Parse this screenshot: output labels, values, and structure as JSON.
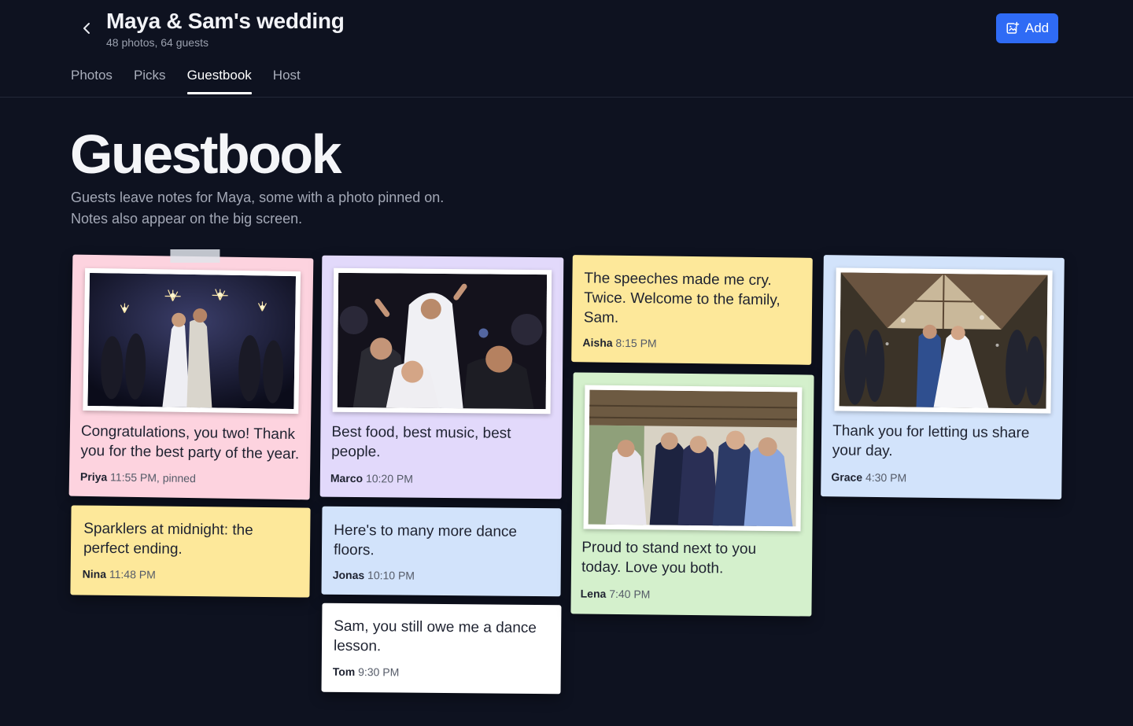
{
  "header": {
    "title": "Maya & Sam's wedding",
    "subtitle": "48 photos, 64 guests",
    "add_label": "Add"
  },
  "tabs": [
    {
      "label": "Photos",
      "active": false
    },
    {
      "label": "Picks",
      "active": false
    },
    {
      "label": "Guestbook",
      "active": true
    },
    {
      "label": "Host",
      "active": false
    }
  ],
  "main": {
    "title": "Guestbook",
    "description_line1": "Guests leave notes for Maya, some with a photo pinned on.",
    "description_line2": "Notes also appear on the big screen."
  },
  "notes": [
    {
      "message": "Congratulations, you two! Thank you for the best party of the year.",
      "author": "Priya",
      "time": "11:55 PM, pinned",
      "color": "#fdd3df",
      "photo": "sparkler-send-off-photo"
    },
    {
      "message": "Sparklers at midnight: the perfect ending.",
      "author": "Nina",
      "time": "11:48 PM",
      "color": "#fde89a"
    },
    {
      "message": "Best food, best music, best people.",
      "author": "Marco",
      "time": "10:20 PM",
      "color": "#e2d9fb",
      "photo": "dance-floor-photo"
    },
    {
      "message": "Here's to many more dance floors.",
      "author": "Jonas",
      "time": "10:10 PM",
      "color": "#d2e3fb"
    },
    {
      "message": "Sam, you still owe me a dance lesson.",
      "author": "Tom",
      "time": "9:30 PM",
      "color": "#ffffff"
    },
    {
      "message": "The speeches made me cry. Twice. Welcome to the family, Sam.",
      "author": "Aisha",
      "time": "8:15 PM",
      "color": "#fde89a"
    },
    {
      "message": "Proud to stand next to you today. Love you both.",
      "author": "Lena",
      "time": "7:40 PM",
      "color": "#d4f0cc",
      "photo": "bridesmaids-photo"
    },
    {
      "message": "Thank you for letting us share your day.",
      "author": "Grace",
      "time": "4:30 PM",
      "color": "#d2e3fb",
      "photo": "bubble-exit-photo"
    }
  ],
  "colors": {
    "background": "#0e1220",
    "accent": "#2f6bf5"
  },
  "icons": {
    "back": "chevron-left-icon",
    "add": "add-photo-icon"
  }
}
